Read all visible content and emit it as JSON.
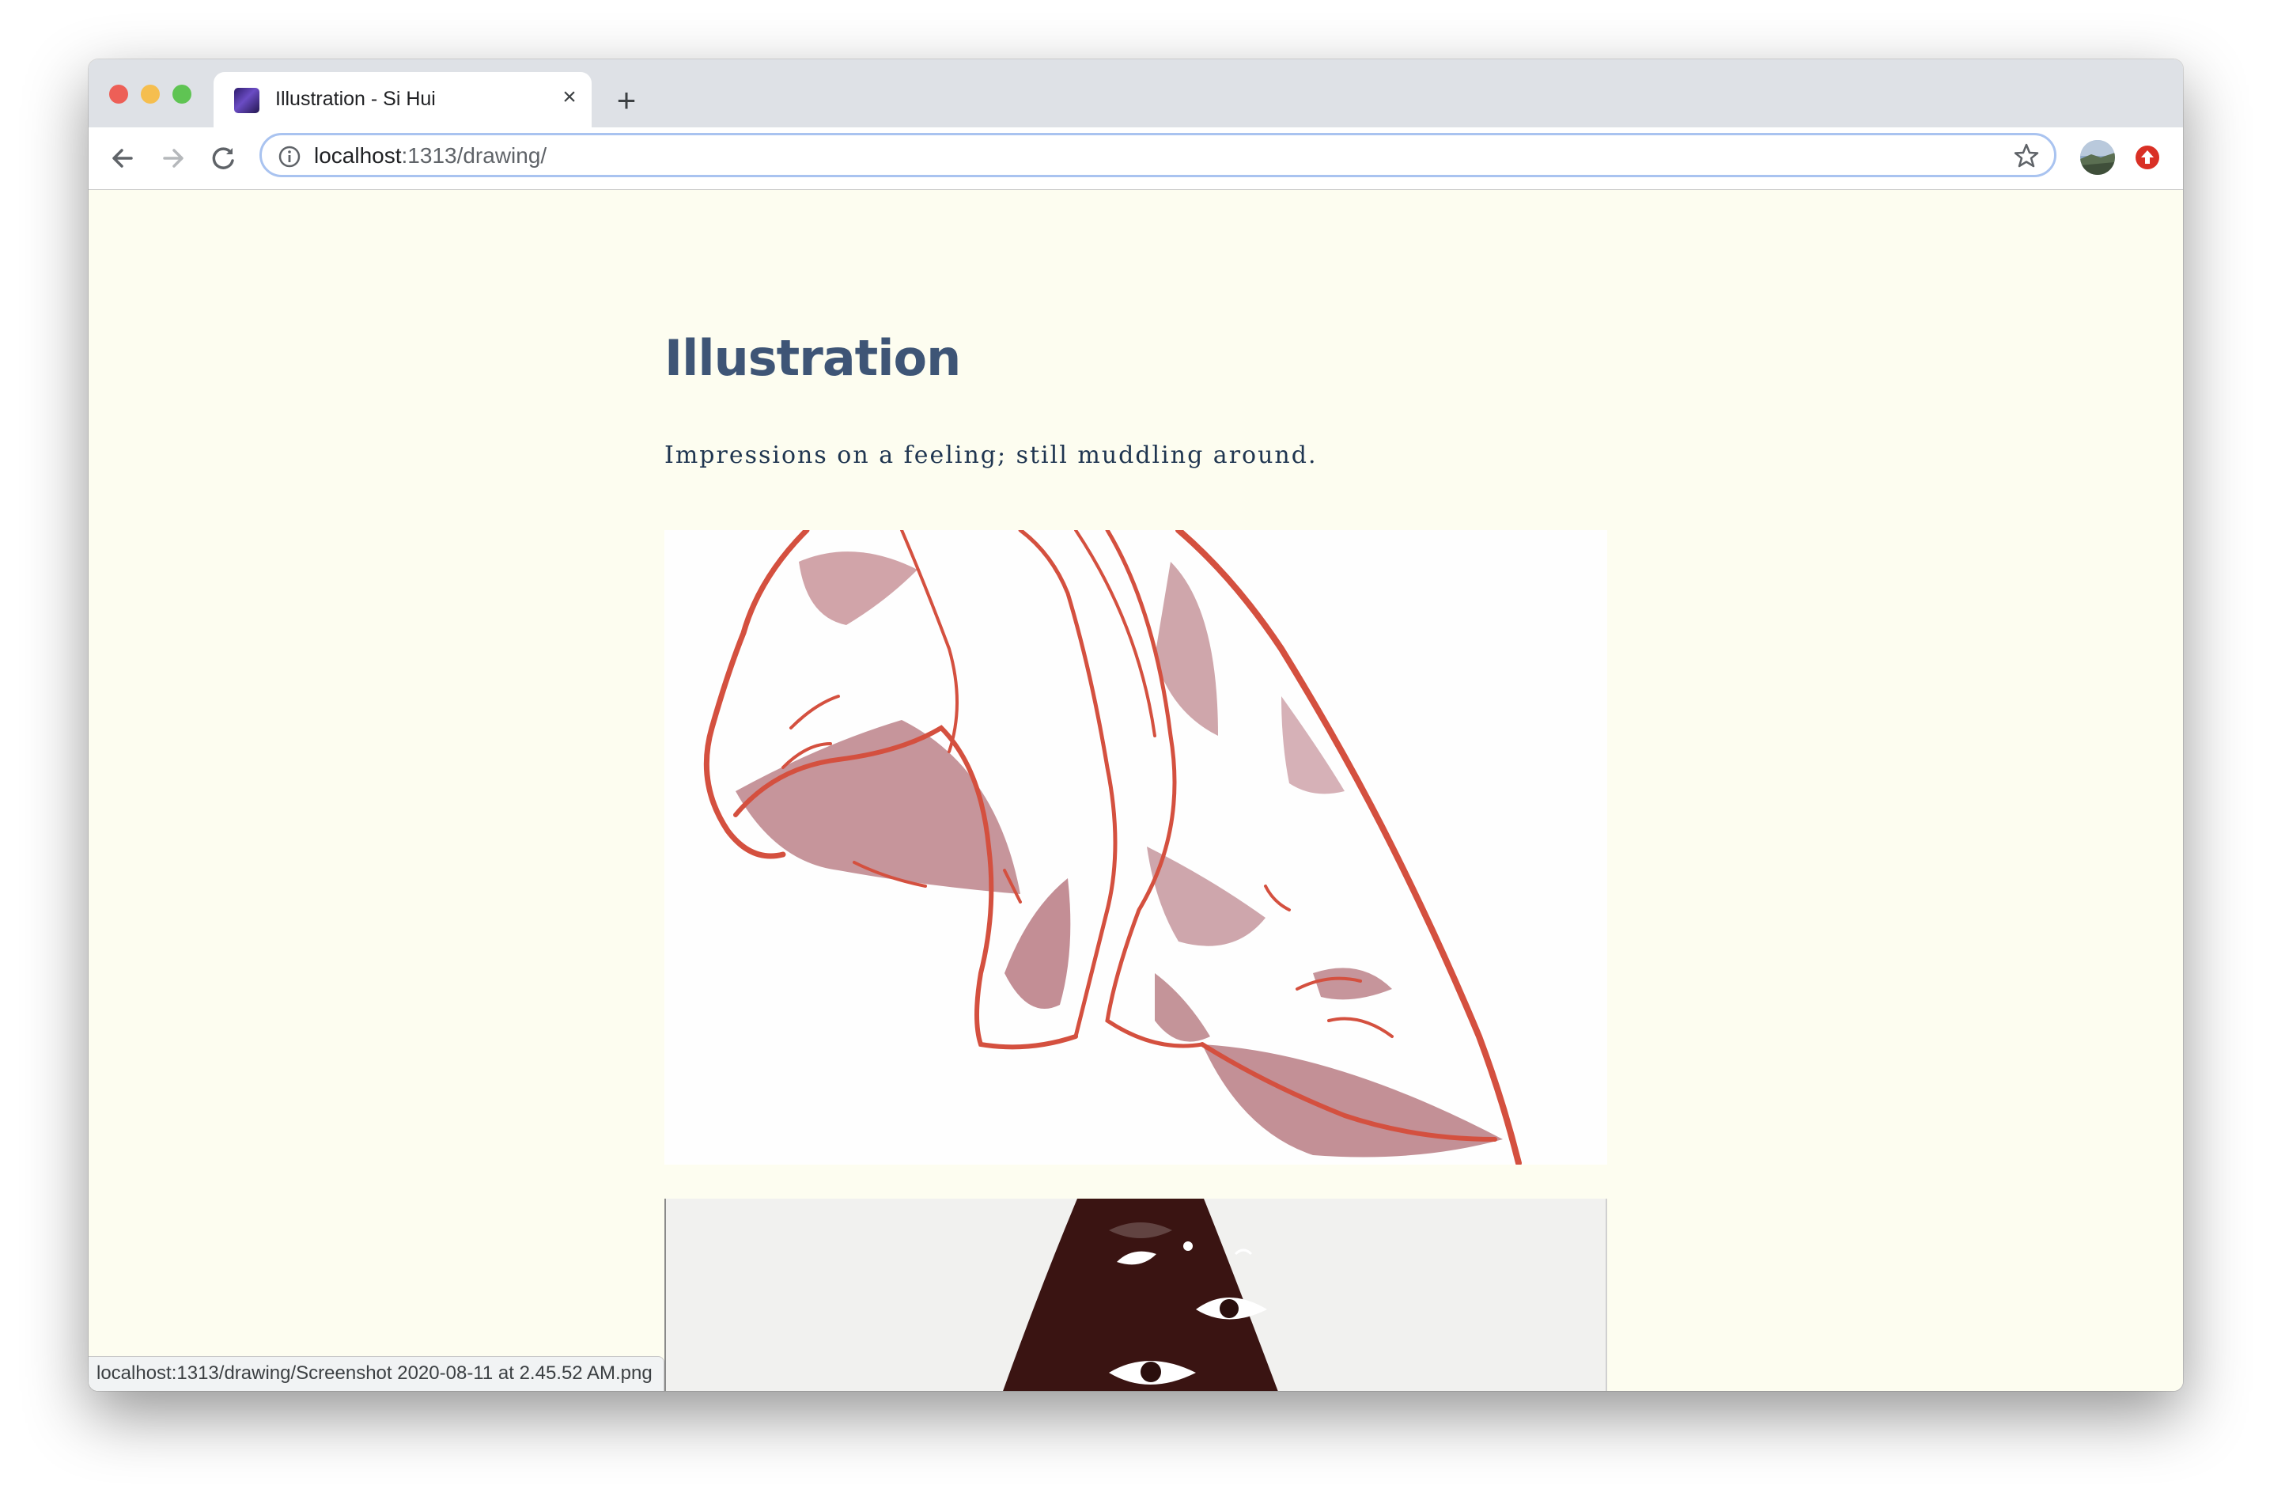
{
  "browser": {
    "tab": {
      "favicon": "galaxy-favicon",
      "title": "Illustration - Si Hui",
      "close_label": "×"
    },
    "new_tab_label": "+",
    "nav": {
      "back_icon": "arrow-left-icon",
      "forward_icon": "arrow-right-icon",
      "reload_icon": "reload-icon"
    },
    "address": {
      "host": "localhost",
      "path": ":1313/drawing/"
    },
    "bookmark_icon": "star-icon",
    "extension_icon": "red-upload-icon"
  },
  "page": {
    "title": "Illustration",
    "subtitle": "Impressions on a feeling; still muddling around.",
    "images": [
      "red-ink-nose-drawing",
      "dark-figure-with-eyes-drawing"
    ]
  },
  "status_bar": {
    "text": "localhost:1313/drawing/Screenshot 2020-08-11 at 2.45.52 AM.png"
  },
  "colors": {
    "page_background": "#fdfdf0",
    "title": "#3e5576",
    "subtitle": "#1f3550",
    "ink_red": "#d4503f",
    "wash_mauve": "#b07079"
  }
}
